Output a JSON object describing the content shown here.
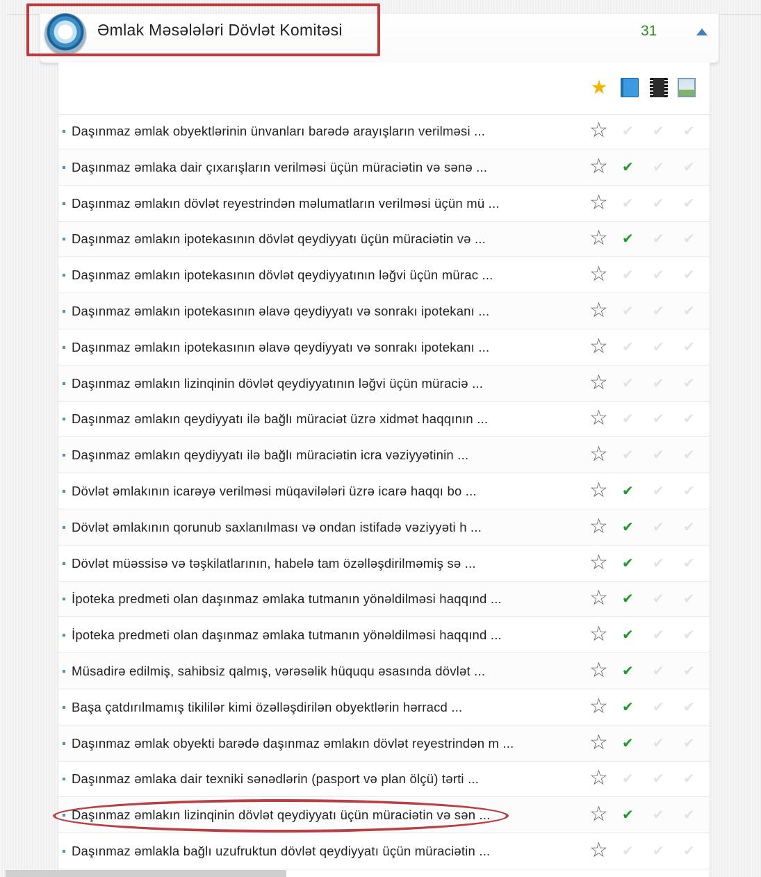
{
  "header": {
    "logo_icon": "state-emblem-logo",
    "title": "Əmlak Məsələləri Dövlət Komitəsi",
    "count": "31",
    "collapse_icon": "triangle-up-icon",
    "count_color": "#2a8a1a",
    "accent_color": "#3b7fbd"
  },
  "toolbar": {
    "icons": [
      "star-icon",
      "book-icon",
      "film-icon",
      "image-icon"
    ]
  },
  "annotation_color": "#c0393b",
  "check_color": "#1c9a2c",
  "services": [
    {
      "label": "Daşınmaz əmlak obyektlərinin ünvanları barədə arayışların verilməsi ...",
      "check": false
    },
    {
      "label": "Daşınmaz əmlaka dair çıxarışların verilməsi üçün müraciətin və sənə ...",
      "check": true
    },
    {
      "label": "Daşınmaz əmlakın dövlət reyestrindən məlumatların verilməsi üçün mü ...",
      "check": false
    },
    {
      "label": "Daşınmaz əmlakın ipotekasının dövlət qeydiyyatı üçün müraciətin və ...",
      "check": true
    },
    {
      "label": "Daşınmaz əmlakın ipotekasının dövlət qeydiyyatının ləğvi üçün mürac ...",
      "check": false
    },
    {
      "label": "Daşınmaz əmlakın ipotekasının əlavə qeydiyyatı və sonrakı ipotekanı ...",
      "check": false
    },
    {
      "label": "Daşınmaz əmlakın ipotekasının əlavə qeydiyyatı və sonrakı ipotekanı ...",
      "check": false
    },
    {
      "label": "Daşınmaz əmlakın lizinqinin dövlət qeydiyyatının ləğvi üçün müraciə ...",
      "check": false
    },
    {
      "label": "Daşınmaz əmlakın qeydiyyatı ilə bağlı müraciət üzrə xidmət haqqının ...",
      "check": false
    },
    {
      "label": "Daşınmaz əmlakın qeydiyyatı ilə bağlı müraciətin icra vəziyyətinin ...",
      "check": false
    },
    {
      "label": "Dövlət əmlakının icarəyə verilməsi müqavilələri üzrə icarə haqqı bo ...",
      "check": true
    },
    {
      "label": "Dövlət əmlakının qorunub saxlanılması və ondan istifadə vəziyyəti h ...",
      "check": true
    },
    {
      "label": "Dövlət müəssisə və təşkilatlarının, habelə tam özəlləşdirilməmiş sə ...",
      "check": true
    },
    {
      "label": "İpoteka predmeti olan daşınmaz əmlaka tutmanın yönəldilməsi haqqınd ...",
      "check": true
    },
    {
      "label": "İpoteka predmeti olan daşınmaz əmlaka tutmanın yönəldilməsi haqqınd ...",
      "check": true
    },
    {
      "label": "Müsadirə edilmiş, sahibsiz qalmış, vərəsəlik hüququ əsasında dövlət ...",
      "check": true
    },
    {
      "label": "Başa çatdırılmamış tikililər kimi özəlləşdirilən obyektlərin hərracd ...",
      "check": true
    },
    {
      "label": "Daşınmaz əmlak obyekti barədə daşınmaz əmlakın dövlət reyestrindən m ...",
      "check": true
    },
    {
      "label": "Daşınmaz əmlaka dair texniki sənədlərin (pasport və plan ölçü) tərti ...",
      "check": false
    },
    {
      "label": "Daşınmaz əmlakın lizinqinin dövlət qeydiyyatı üçün müraciətin və sən ...",
      "check": true
    },
    {
      "label": "Daşınmaz əmlakla bağlı uzufruktun dövlət qeydiyyatı üçün müraciətin ...",
      "check": false
    }
  ]
}
